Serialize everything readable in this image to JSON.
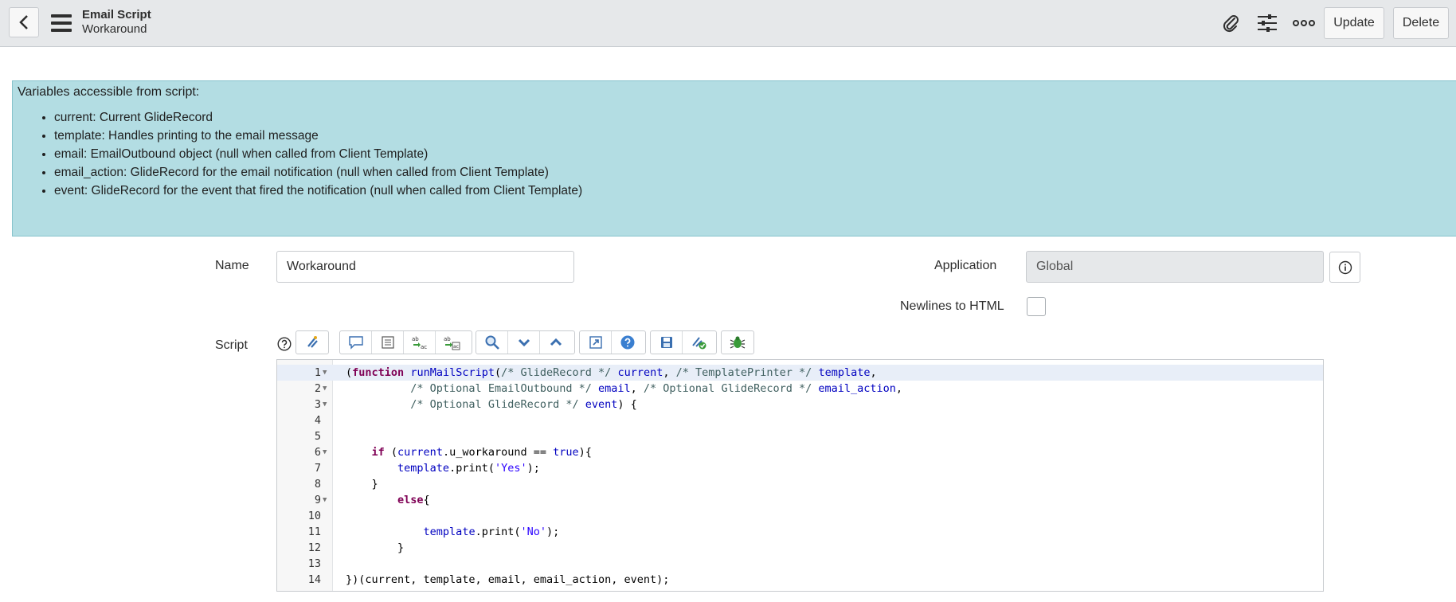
{
  "header": {
    "title": "Email Script",
    "subtitle": "Workaround",
    "update_label": "Update",
    "delete_label": "Delete"
  },
  "info": {
    "title": "Variables accessible from script:",
    "items": [
      "current: Current GlideRecord",
      "template: Handles printing to the email message",
      "email: EmailOutbound object (null when called from Client Template)",
      "email_action: GlideRecord for the email notification (null when called from Client Template)",
      "event: GlideRecord for the event that fired the notification (null when called from Client Template)"
    ]
  },
  "form": {
    "name_label": "Name",
    "name_value": "Workaround",
    "application_label": "Application",
    "application_value": "Global",
    "newlines_label": "Newlines to HTML",
    "script_label": "Script"
  },
  "editor": {
    "line_numbers": [
      "1",
      "2",
      "3",
      "4",
      "5",
      "6",
      "7",
      "8",
      "9",
      "10",
      "11",
      "12",
      "13",
      "14"
    ]
  },
  "colors": {
    "header_bg": "#e6e8ea",
    "info_bg": "#b3dde3",
    "keyword": "#7f0055",
    "identifier": "#0000c0",
    "comment": "#3f5f5f"
  }
}
